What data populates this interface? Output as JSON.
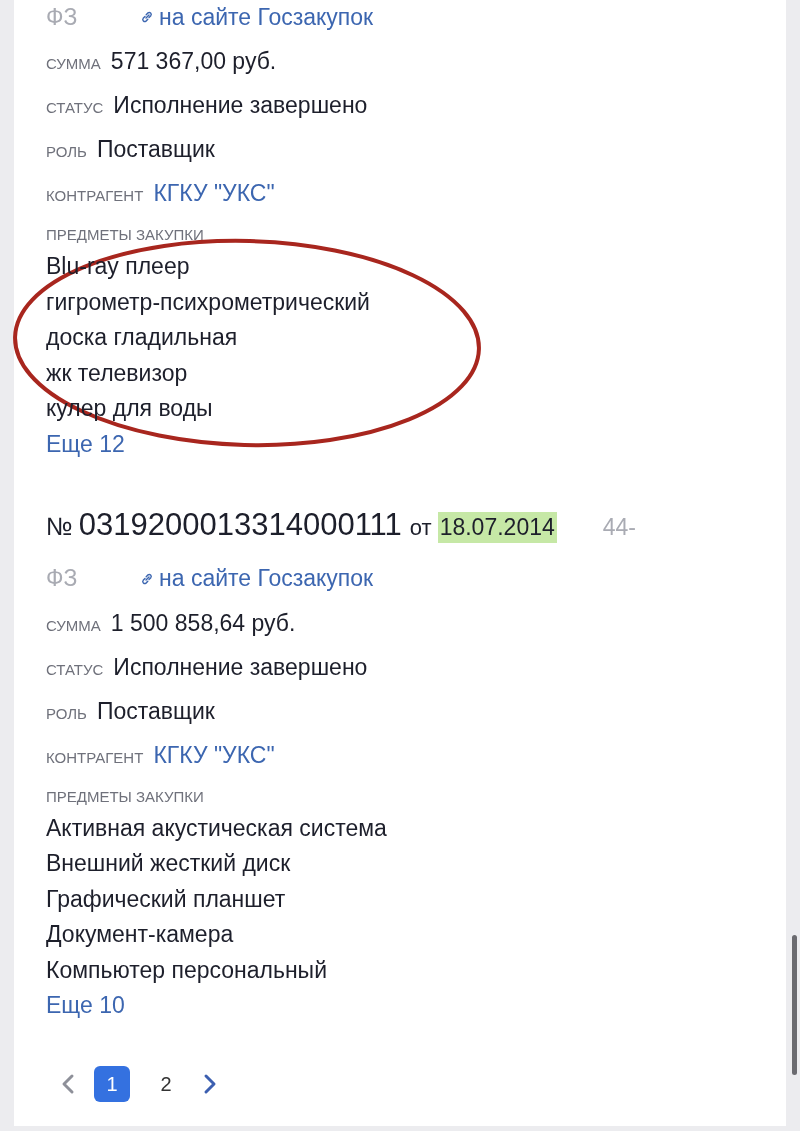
{
  "contracts": [
    {
      "law_line2": "ФЗ",
      "source_link": "на сайте Госзакупок",
      "fields": [
        {
          "label": "СУММА",
          "value": "571 367,00 руб.",
          "kind": "text"
        },
        {
          "label": "СТАТУС",
          "value": "Исполнение завершено",
          "kind": "text"
        },
        {
          "label": "РОЛЬ",
          "value": "Поставщик",
          "kind": "text"
        },
        {
          "label": "КОНТРАГЕНТ",
          "value": "КГКУ \"УКС\"",
          "kind": "link"
        }
      ],
      "subjects_label": "ПРЕДМЕТЫ ЗАКУПКИ",
      "subjects": [
        "Blu-ray плеер",
        "гигрометр-психрометрический",
        "доска гладильная",
        "жк телевизор",
        "кулер для воды"
      ],
      "more": "Еще 12",
      "circled": true
    },
    {
      "header": {
        "number_sign": "№",
        "number": "0319200013314000111",
        "date_prefix": "от",
        "date": "18.07.2014",
        "date_highlighted": true,
        "law_line1": "44-"
      },
      "law_line2": "ФЗ",
      "source_link": "на сайте Госзакупок",
      "fields": [
        {
          "label": "СУММА",
          "value": "1 500 858,64 руб.",
          "kind": "text"
        },
        {
          "label": "СТАТУС",
          "value": "Исполнение завершено",
          "kind": "text"
        },
        {
          "label": "РОЛЬ",
          "value": "Поставщик",
          "kind": "text"
        },
        {
          "label": "КОНТРАГЕНТ",
          "value": "КГКУ \"УКС\"",
          "kind": "link"
        }
      ],
      "subjects_label": "ПРЕДМЕТЫ ЗАКУПКИ",
      "subjects": [
        "Активная акустическая система",
        "Внешний жесткий диск",
        "Графический планшет",
        "Документ-камера",
        "Компьютер персональный"
      ],
      "more": "Еще 10",
      "circled": false
    }
  ],
  "pagination": {
    "prev": {
      "disabled": true
    },
    "pages": [
      {
        "label": "1",
        "selected": true
      },
      {
        "label": "2",
        "selected": false
      }
    ],
    "next": {
      "disabled": false
    }
  }
}
